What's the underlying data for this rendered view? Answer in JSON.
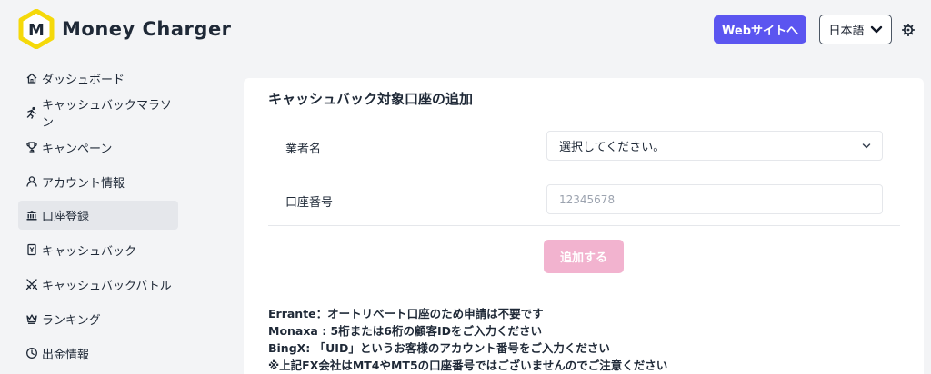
{
  "brand": {
    "name": "Money Charger",
    "logo_letter": "M",
    "accent_yellow": "#f5d90a",
    "accent_purple": "#5b55f0",
    "accent_pink": "#f2b3cf"
  },
  "header": {
    "website_button": "Webサイトへ",
    "language": "日本語",
    "settings_icon": "gear-icon"
  },
  "sidebar": {
    "items": [
      {
        "label": "ダッシュボード",
        "icon": "home-icon"
      },
      {
        "label": "キャッシュバックマラソン",
        "icon": "runner-icon"
      },
      {
        "label": "キャンペーン",
        "icon": "trophy-icon"
      },
      {
        "label": "アカウント情報",
        "icon": "user-icon"
      },
      {
        "label": "口座登録",
        "icon": "bank-icon",
        "active": true
      },
      {
        "label": "キャッシュバック",
        "icon": "cashback-icon"
      },
      {
        "label": "キャッシュバックバトル",
        "icon": "battle-icon"
      },
      {
        "label": "ランキング",
        "icon": "crown-icon"
      },
      {
        "label": "出金情報",
        "icon": "clock-icon"
      }
    ]
  },
  "form": {
    "title": "キャッシュバック対象口座の追加",
    "broker_label": "業者名",
    "broker_selected": "選択してください。",
    "account_label": "口座番号",
    "account_placeholder": "12345678",
    "submit_label": "追加する"
  },
  "notes": [
    "Errante：オートリベート口座のため申請は不要です",
    "Monaxa : 5桁または6桁の顧客IDをご入力ください",
    "BingX: 「UID」というお客様のアカウント番号をご入力ください",
    "※上記FX会社はMT4やMT5の口座番号ではございませんのでご注意ください"
  ]
}
